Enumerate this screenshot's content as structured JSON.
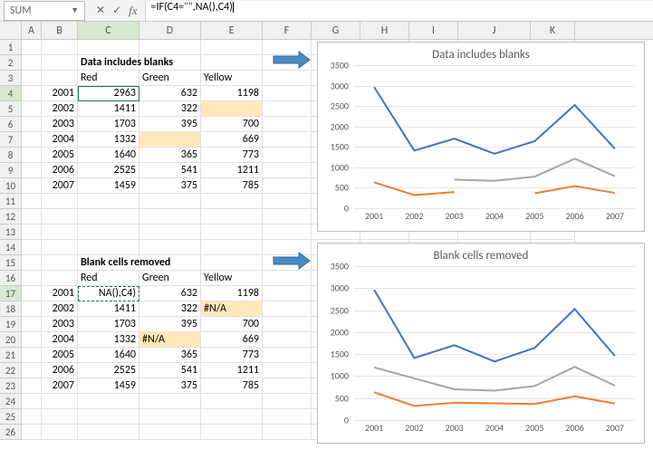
{
  "formula_bar": {
    "name_box": "SUM",
    "cancel": "✕",
    "confirm": "✓",
    "fx": "fx",
    "formula_plain": "=IF(C4=\"\",NA(),C4)"
  },
  "columns": [
    "A",
    "B",
    "C",
    "D",
    "E",
    "F",
    "G",
    "H",
    "I",
    "J",
    "K"
  ],
  "rows": [
    "1",
    "2",
    "3",
    "4",
    "5",
    "6",
    "7",
    "8",
    "9",
    "10",
    "11",
    "12",
    "13",
    "14",
    "15",
    "16",
    "17",
    "18",
    "19",
    "20",
    "21",
    "22",
    "23",
    "24",
    "25",
    "26"
  ],
  "section1_title": "Data includes blanks",
  "section2_title": "Blank cells removed",
  "headers": {
    "red": "Red",
    "green": "Green",
    "yellow": "Yellow"
  },
  "years": [
    "2001",
    "2002",
    "2003",
    "2004",
    "2005",
    "2006",
    "2007"
  ],
  "table1": {
    "red": [
      "2963",
      "1411",
      "1703",
      "1332",
      "1640",
      "2525",
      "1459"
    ],
    "green": [
      "632",
      "322",
      "395",
      "",
      "365",
      "541",
      "375"
    ],
    "yellow": [
      "1198",
      "",
      "700",
      "669",
      "773",
      "1211",
      "785"
    ]
  },
  "table2": {
    "red": [
      "NA(),C4)",
      "1411",
      "1703",
      "1332",
      "1640",
      "2525",
      "1459"
    ],
    "green": [
      "632",
      "322",
      "395",
      "#N/A",
      "365",
      "541",
      "375"
    ],
    "yellow": [
      "1198",
      "#N/A",
      "700",
      "669",
      "773",
      "1211",
      "785"
    ]
  },
  "chart1_title": "Data includes blanks",
  "chart2_title": "Blank cells removed",
  "chart_data": [
    {
      "type": "line",
      "title": "Data includes blanks",
      "xlabel": "",
      "ylabel": "",
      "ylim": [
        0,
        3500
      ],
      "yticks": [
        0,
        500,
        1000,
        1500,
        2000,
        2500,
        3000,
        3500
      ],
      "categories": [
        "2001",
        "2002",
        "2003",
        "2004",
        "2005",
        "2006",
        "2007"
      ],
      "series": [
        {
          "name": "Red",
          "color": "#4472C4",
          "values": [
            2963,
            1411,
            1703,
            1332,
            1640,
            2525,
            1459
          ]
        },
        {
          "name": "Green",
          "color": "#ED7D31",
          "values": [
            632,
            322,
            395,
            null,
            365,
            541,
            375
          ]
        },
        {
          "name": "Yellow",
          "color": "#A5A5A5",
          "values": [
            1198,
            null,
            700,
            669,
            773,
            1211,
            785
          ]
        }
      ]
    },
    {
      "type": "line",
      "title": "Blank cells removed",
      "xlabel": "",
      "ylabel": "",
      "ylim": [
        0,
        3500
      ],
      "yticks": [
        0,
        500,
        1000,
        1500,
        2000,
        2500,
        3000,
        3500
      ],
      "categories": [
        "2001",
        "2002",
        "2003",
        "2004",
        "2005",
        "2006",
        "2007"
      ],
      "series": [
        {
          "name": "Red",
          "color": "#4472C4",
          "values": [
            2963,
            1411,
            1703,
            1332,
            1640,
            2525,
            1459
          ]
        },
        {
          "name": "Green",
          "color": "#ED7D31",
          "values": [
            632,
            322,
            395,
            null,
            365,
            541,
            375
          ]
        },
        {
          "name": "Yellow",
          "color": "#A5A5A5",
          "values": [
            1198,
            null,
            700,
            669,
            773,
            1211,
            785
          ]
        }
      ]
    }
  ]
}
